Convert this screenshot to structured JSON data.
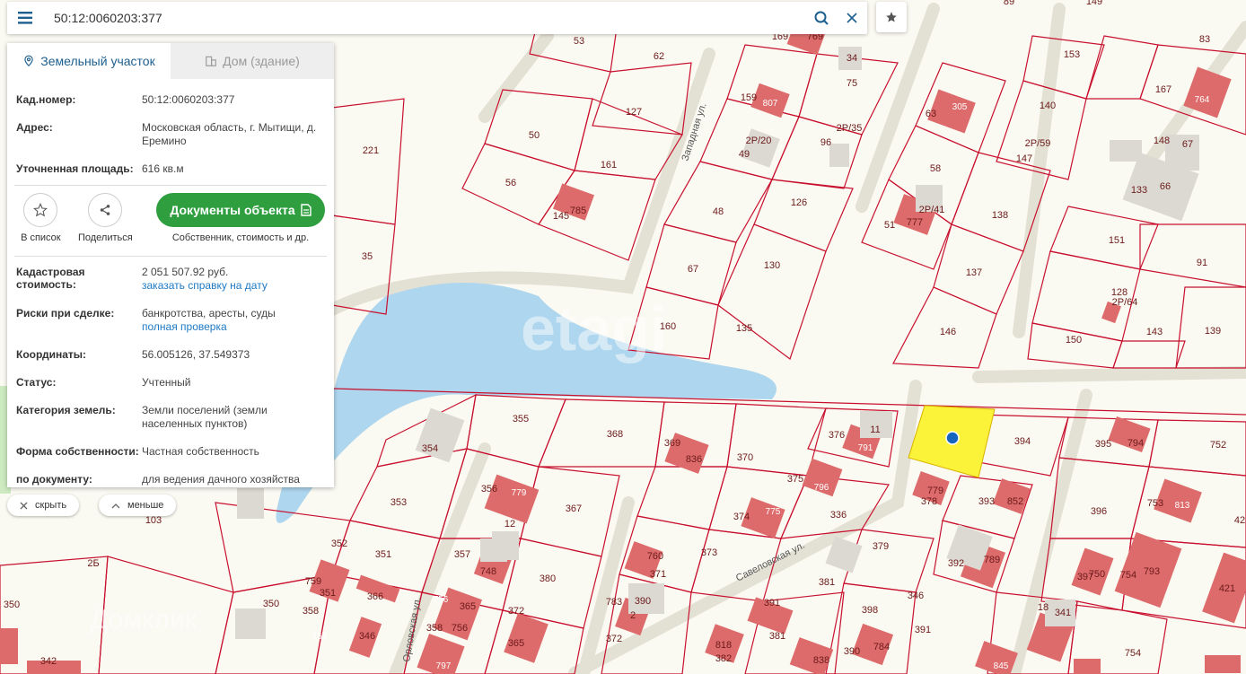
{
  "search": {
    "query": "50:12:0060203:377"
  },
  "tabs": [
    {
      "label": "Земельный участок",
      "active": true
    },
    {
      "label": "Дом (здание)",
      "active": false
    }
  ],
  "info": {
    "cadnum": {
      "label": "Кад.номер:",
      "value": "50:12:0060203:377"
    },
    "address": {
      "label": "Адрес:",
      "value": "Московская область, г. Мытищи, д. Еремино"
    },
    "area": {
      "label": "Уточненная площадь:",
      "value": "616 кв.м"
    },
    "cad_value": {
      "label": "Кадастровая стоимость:",
      "value": "2 051 507.92 руб.",
      "link": "заказать справку на дату"
    },
    "risks": {
      "label": "Риски при сделке:",
      "value": "банкротства, аресты, суды",
      "link": "полная проверка"
    },
    "coords": {
      "label": "Координаты:",
      "value": "56.005126, 37.549373"
    },
    "status": {
      "label": "Статус:",
      "value": "Учтенный"
    },
    "category": {
      "label": "Категория земель:",
      "value": "Земли поселений (земли населенных пунктов)"
    },
    "ownership": {
      "label": "Форма собственности:",
      "value": "Частная собственность"
    },
    "by_doc": {
      "label": "по документу:",
      "value": "для ведения дачного хозяйства"
    }
  },
  "actions": {
    "to_list": "В список",
    "share": "Поделиться",
    "docs_button": "Документы объекта",
    "docs_sub": "Собственник, стоимость и др."
  },
  "controls": {
    "hide": "скрыть",
    "less": "меньше"
  },
  "watermarks": {
    "etagi": "etagi",
    "domclick": "Домклик"
  },
  "colors": {
    "accent": "#1d5f8f",
    "green": "#2e9e3f",
    "parcel_line": "#c8102e",
    "selected": "#fbf23a",
    "building": "#de6b6b",
    "water": "#aed6ee"
  },
  "map": {
    "streets": [
      "Западная ул.",
      "Савеловская ул.",
      "Орловская ул."
    ],
    "parcels": [
      "53",
      "62",
      "89",
      "149",
      "83",
      "169",
      "769",
      "34",
      "75",
      "127",
      "159",
      "807",
      "2P/20",
      "49",
      "2P/35",
      "96",
      "63",
      "305",
      "140",
      "153",
      "167",
      "764",
      "148",
      "67",
      "133",
      "66",
      "2P/59",
      "147",
      "50",
      "161",
      "56",
      "145",
      "785",
      "48",
      "126",
      "58",
      "2P/41",
      "51",
      "777",
      "138",
      "151",
      "91",
      "221",
      "35",
      "67",
      "130",
      "137",
      "128",
      "2P/64",
      "143",
      "139",
      "160",
      "135",
      "146",
      "150",
      "355",
      "368",
      "11",
      "394",
      "395",
      "794",
      "752",
      "354",
      "369",
      "836",
      "370",
      "376",
      "791",
      "375",
      "796",
      "753",
      "813",
      "396",
      "42",
      "356",
      "779",
      "12",
      "367",
      "374",
      "775",
      "336",
      "378",
      "779",
      "393",
      "852",
      "353",
      "103",
      "357",
      "748",
      "373",
      "760",
      "371",
      "379",
      "392",
      "789",
      "397",
      "750",
      "754",
      "793",
      "421",
      "352",
      "351",
      "759",
      "351",
      "366",
      "380",
      "381",
      "391",
      "346",
      "350",
      "358",
      "756",
      "365",
      "372",
      "783",
      "2",
      "390",
      "398",
      "18",
      "341",
      "350",
      "769",
      "346",
      "358",
      "756",
      "365",
      "372",
      "382",
      "381",
      "390",
      "784",
      "391",
      "818",
      "754",
      "342",
      "797",
      "838",
      "845",
      "2Б"
    ]
  }
}
